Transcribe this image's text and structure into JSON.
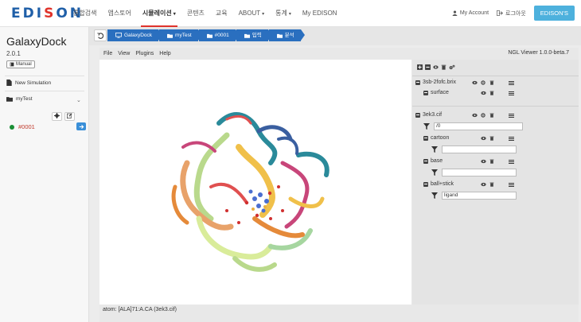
{
  "topnav": {
    "logo_prefix": "EDI",
    "logo_accent": "S",
    "logo_suffix": "ON",
    "items": [
      {
        "label": "통합검색",
        "caret": ""
      },
      {
        "label": "앱스토어",
        "caret": ""
      },
      {
        "label": "시뮬레이션",
        "caret": "▾"
      },
      {
        "label": "콘텐츠",
        "caret": ""
      },
      {
        "label": "교육",
        "caret": ""
      },
      {
        "label": "ABOUT",
        "caret": "▾"
      },
      {
        "label": "통계",
        "caret": "▾"
      },
      {
        "label": "My EDISON",
        "caret": ""
      }
    ],
    "my_account": "My Account",
    "logout": "로그아웃",
    "edisons_button": "EDISON'S",
    "active_index": 2
  },
  "sidebar": {
    "app_title": "GalaxyDock",
    "version": "2.0.1",
    "manual": "Manual",
    "new_simulation": "New Simulation",
    "folder": "myTest",
    "job": "#0001"
  },
  "breadcrumb": {
    "back_icon": "undo-icon",
    "items": [
      "GalaxyDock",
      "myTest",
      "#0001",
      "입력",
      "분석"
    ]
  },
  "viewer": {
    "menu": [
      "File",
      "View",
      "Plugins",
      "Help"
    ],
    "version": "NGL Viewer 1.0.0-beta.7",
    "status": "atom: [ALA]71:A.CA (3ek3.cif)"
  },
  "panel": {
    "components": [
      {
        "name": "3sb-2fofc.brix",
        "reprs": [
          {
            "name": "surface",
            "filter": null
          }
        ]
      },
      {
        "name": "3ek3.cif",
        "filter": "/0",
        "reprs": [
          {
            "name": "cartoon",
            "filter": ""
          },
          {
            "name": "base",
            "filter": ""
          },
          {
            "name": "ball+stick",
            "filter": "ligand"
          }
        ]
      }
    ]
  },
  "colors": {
    "brand_blue": "#1f5fa8",
    "brand_red": "#e0332b",
    "breadcrumb_blue": "#2a6fbf",
    "edisons_button": "#4db1dd",
    "job_status_green": "#1a8f35",
    "job_link_red": "#c0392b"
  }
}
